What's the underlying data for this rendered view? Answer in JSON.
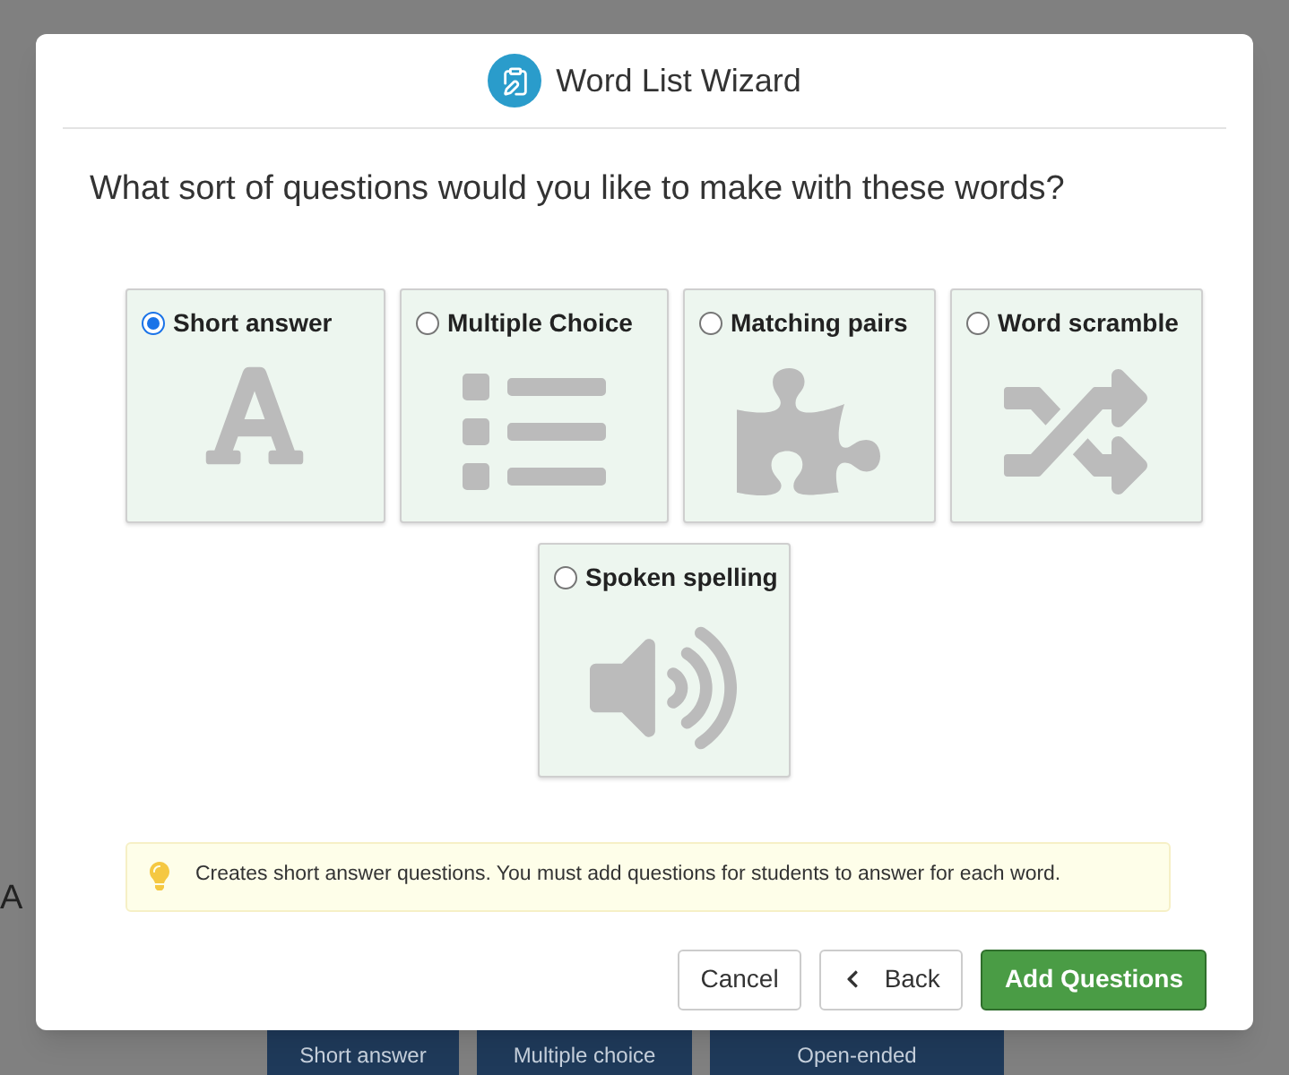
{
  "background": {
    "heading": "A",
    "tiles": [
      "Short answer",
      "Multiple choice",
      "Open-ended"
    ]
  },
  "dialog": {
    "title": "Word List Wizard",
    "question": "What sort of questions would you like to make with these words?",
    "options": [
      {
        "label": "Short answer",
        "kind": "letter",
        "selected": true
      },
      {
        "label": "Multiple Choice",
        "kind": "list",
        "selected": false
      },
      {
        "label": "Matching pairs",
        "kind": "puzzle",
        "selected": false
      },
      {
        "label": "Word scramble",
        "kind": "shuffle",
        "selected": false
      },
      {
        "label": "Spoken spelling",
        "kind": "speaker",
        "selected": false
      }
    ],
    "hint": "Creates short answer questions. You must add questions for students to answer for each word.",
    "buttons": {
      "cancel": "Cancel",
      "back": "Back",
      "primary": "Add Questions"
    }
  }
}
